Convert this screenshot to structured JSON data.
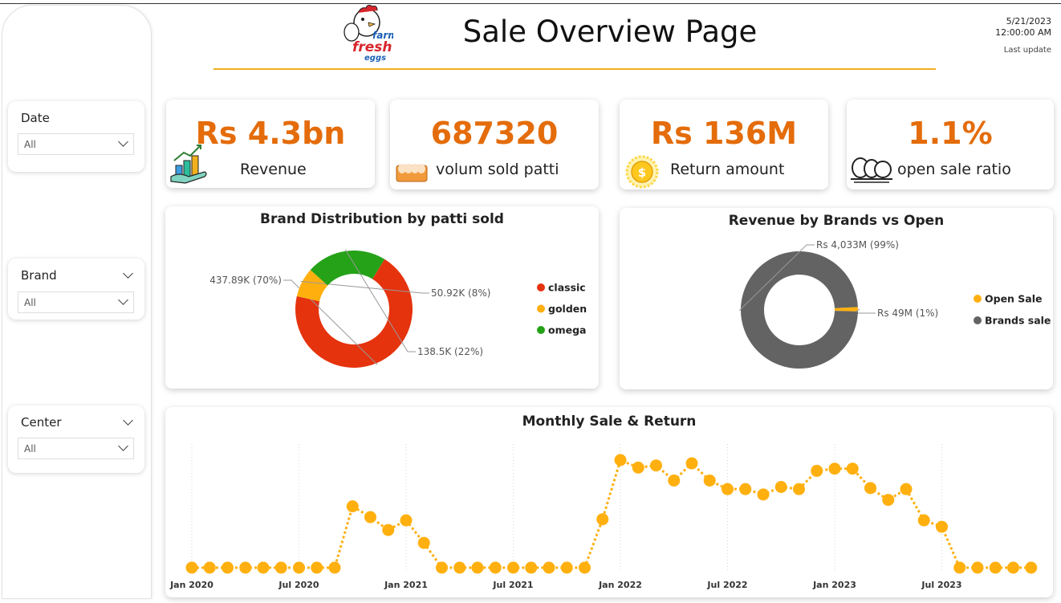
{
  "header": {
    "title": "Sale Overview Page",
    "logo_text": [
      "farm",
      "fresh",
      "eggs"
    ],
    "update_date": "5/21/2023",
    "update_time": "12:00:00 AM",
    "update_label": "Last update",
    "accent_color": "#f2b01e"
  },
  "slicers": [
    {
      "title": "Date",
      "value": "All",
      "has_header_chevron": false
    },
    {
      "title": "Brand",
      "value": "All",
      "has_header_chevron": true
    },
    {
      "title": "Center",
      "value": "All",
      "has_header_chevron": true
    }
  ],
  "kpis": [
    {
      "value": "Rs 4.3bn",
      "label": "Revenue",
      "icon": "money-growth-icon"
    },
    {
      "value": "687320",
      "label": "volum sold patti",
      "icon": "egg-tray-icon"
    },
    {
      "value": "Rs 136M",
      "label": "Return amount",
      "icon": "coin-icon"
    },
    {
      "value": "1.1%",
      "label": "open sale ratio",
      "icon": "eggs-icon"
    }
  ],
  "chart_data": [
    {
      "type": "pie",
      "style": "donut",
      "title": "Brand Distribution by patti sold",
      "categories": [
        "classic",
        "golden",
        "omega"
      ],
      "values": [
        437890,
        50920,
        138500
      ],
      "labels": [
        "437.89K (70%)",
        "50.92K (8%)",
        "138.5K (22%)"
      ],
      "colors": [
        "#e5330e",
        "#ffb00f",
        "#25a218"
      ],
      "legend_position": "right"
    },
    {
      "type": "pie",
      "style": "donut",
      "title": "Revenue by Brands vs Open",
      "categories": [
        "Open Sale",
        "Brands sale"
      ],
      "values": [
        49,
        4033
      ],
      "labels": [
        "Rs 49M (1%)",
        "Rs 4,033M (99%)"
      ],
      "colors": [
        "#ffb00f",
        "#636363"
      ],
      "legend_position": "right"
    },
    {
      "type": "line",
      "title": "Monthly Sale & Return",
      "x_tick_labels": [
        "Jan 2020",
        "Jul 2020",
        "Jan 2021",
        "Jul 2021",
        "Jan 2022",
        "Jul 2022",
        "Jan 2023",
        "Jul 2023"
      ],
      "x_start": "Jan 2020",
      "x_end": "Dec 2023",
      "color": "#ffb00f",
      "line_style": "dotted",
      "grid": "vertical dotted",
      "series": [
        {
          "values": [
            0,
            0,
            0,
            0,
            0,
            0,
            0,
            0,
            0,
            57,
            47,
            35,
            44,
            23,
            0,
            0,
            0,
            0,
            0,
            0,
            0,
            0,
            0,
            45,
            100,
            93,
            95,
            81,
            97,
            81,
            73,
            73,
            68,
            75,
            73,
            90,
            92,
            92,
            74,
            63,
            73,
            44,
            38,
            0,
            0,
            0,
            0,
            0
          ]
        }
      ]
    }
  ]
}
